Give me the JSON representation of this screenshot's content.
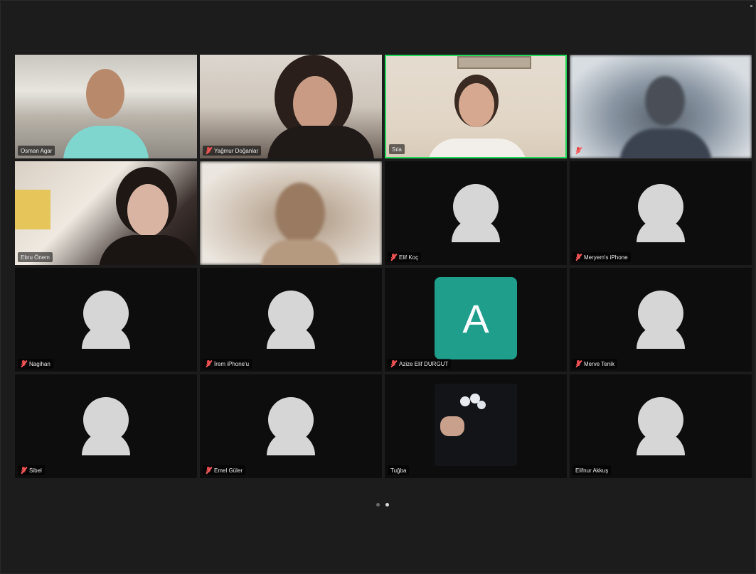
{
  "meeting": {
    "pager": {
      "pages": 2,
      "current_page": 2
    },
    "colors": {
      "background": "#1c1c1c",
      "tile": "#0d0d0d",
      "active_speaker_border": "#23d959",
      "muted_mic": "#e24a4a",
      "avatar_placeholder": "#d6d6d6",
      "initial_tile": "#1f9e8c"
    },
    "participants": [
      {
        "name": "Osman Agar",
        "muted": false,
        "type": "video"
      },
      {
        "name": "Yağmur Doğanlar",
        "muted": true,
        "type": "video"
      },
      {
        "name": "Sıla",
        "muted": false,
        "type": "video",
        "active_speaker": true
      },
      {
        "name": "",
        "muted": true,
        "type": "video"
      },
      {
        "name": "Ebru Önem",
        "muted": false,
        "type": "video"
      },
      {
        "name": "",
        "muted": false,
        "type": "video"
      },
      {
        "name": "Elif Koç",
        "muted": true,
        "type": "avatar"
      },
      {
        "name": "Meryem's iPhone",
        "muted": true,
        "type": "avatar"
      },
      {
        "name": "Nagihan",
        "muted": true,
        "type": "avatar"
      },
      {
        "name": "İrem iPhone'u",
        "muted": true,
        "type": "avatar"
      },
      {
        "name": "Azize Elif DURGUT",
        "muted": true,
        "type": "initial",
        "initial": "A"
      },
      {
        "name": "Merve Tenik",
        "muted": true,
        "type": "avatar"
      },
      {
        "name": "Sibel",
        "muted": true,
        "type": "avatar"
      },
      {
        "name": "Emel Güler",
        "muted": true,
        "type": "avatar"
      },
      {
        "name": "Tuğba",
        "muted": false,
        "type": "photo"
      },
      {
        "name": "Elifnur Akkuş",
        "muted": false,
        "type": "avatar"
      }
    ]
  }
}
